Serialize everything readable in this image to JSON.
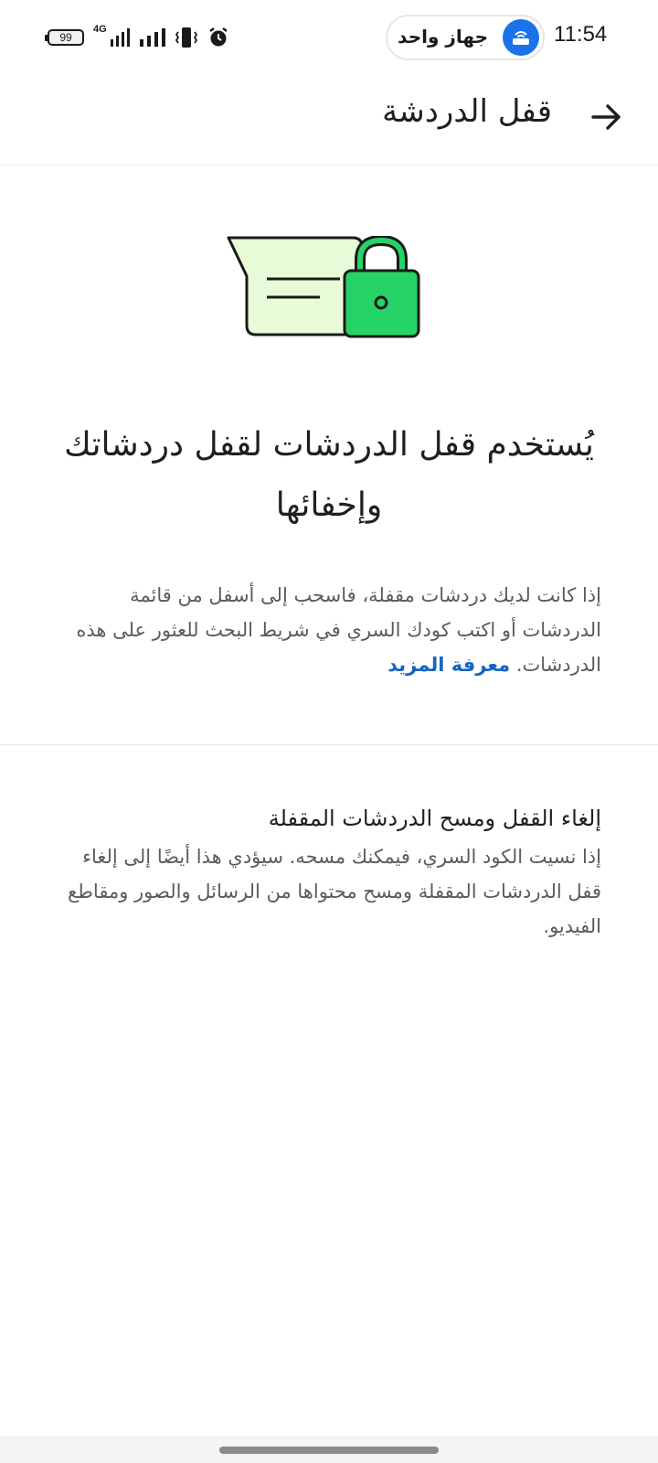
{
  "status_bar": {
    "time": "11:54",
    "hotspot_label": "جهاز واحد",
    "battery_level": "99",
    "network_type": "4G"
  },
  "header": {
    "title": "قفل الدردشة"
  },
  "main": {
    "heading": "يُستخدم قفل الدردشات لقفل دردشاتك وإخفائها",
    "description": "إذا كانت لديك دردشات مقفلة، فاسحب إلى أسفل من قائمة الدردشات أو اكتب كودك السري في شريط البحث للعثور على هذه الدردشات.",
    "learn_more": "معرفة المزيد"
  },
  "unlock_option": {
    "title": "إلغاء القفل ومسح الدردشات المقفلة",
    "description": "إذا نسيت الكود السري، فيمكنك مسحه. سيؤدي هذا أيضًا إلى إلغاء قفل الدردشات المقفلة ومسح محتواها من الرسائل والصور ومقاطع الفيديو."
  },
  "colors": {
    "accent_link": "#1565c0",
    "lock_green": "#25d366",
    "bubble_fill": "#e7fbd9",
    "hotspot_blue": "#1a73e8"
  }
}
